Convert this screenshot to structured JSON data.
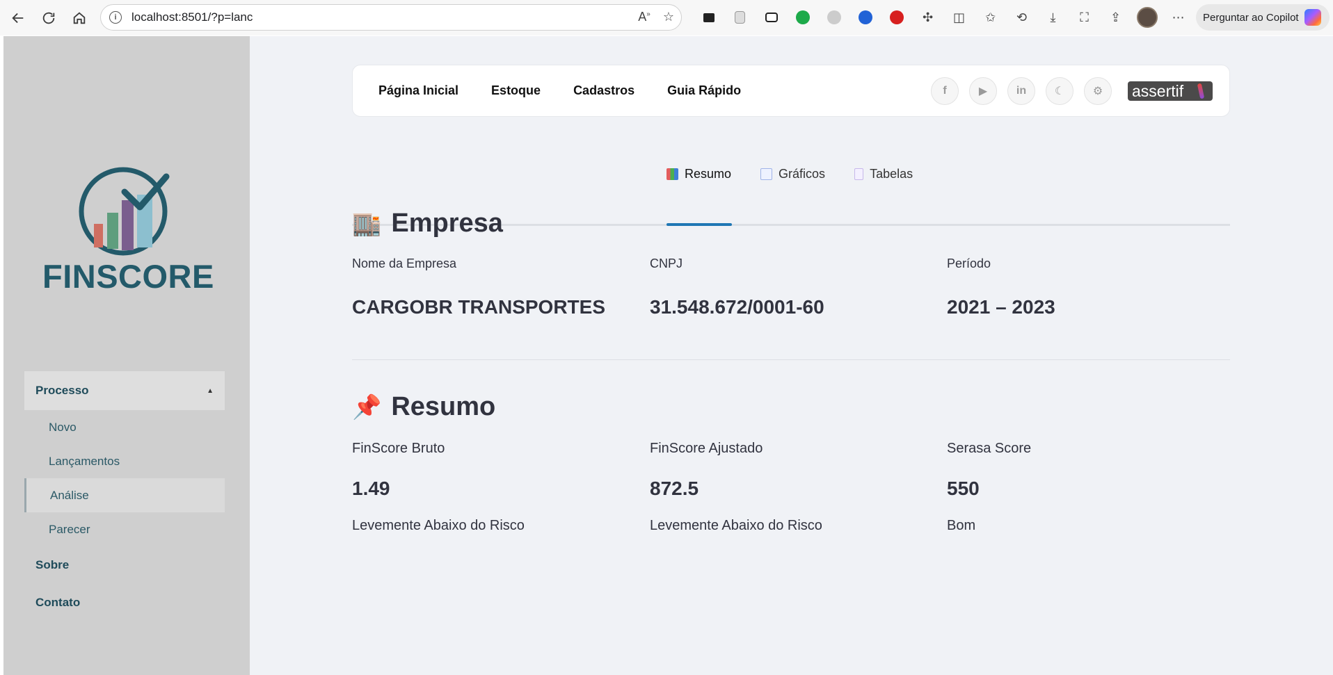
{
  "browser": {
    "url": "localhost:8501/?p=lanc",
    "copilot_label": "Perguntar ao Copilot"
  },
  "sidebar": {
    "logo_text": "FINSCORE",
    "menu": {
      "group_label": "Processo",
      "items": [
        "Novo",
        "Lançamentos",
        "Análise",
        "Parecer"
      ],
      "active_item": "Análise",
      "top_items": [
        "Sobre",
        "Contato"
      ]
    }
  },
  "topnav": {
    "links": [
      "Página Inicial",
      "Estoque",
      "Cadastros",
      "Guia Rápido"
    ],
    "brand_badge": "assertif"
  },
  "tabs": {
    "items": [
      {
        "label": "Resumo",
        "icon": "bar-chart-icon"
      },
      {
        "label": "Gráficos",
        "icon": "line-chart-icon"
      },
      {
        "label": "Tabelas",
        "icon": "document-icon"
      }
    ],
    "active": "Resumo"
  },
  "empresa": {
    "title": "Empresa",
    "emoji": "🏬",
    "fields": [
      {
        "label": "Nome da Empresa",
        "value": "CARGOBR TRANSPORTES"
      },
      {
        "label": "CNPJ",
        "value": "31.548.672/0001-60"
      },
      {
        "label": "Período",
        "value": "2021 – 2023"
      }
    ]
  },
  "resumo": {
    "title": "Resumo",
    "emoji": "📌",
    "metrics": [
      {
        "label": "FinScore Bruto",
        "value": "1.49",
        "status": "Levemente Abaixo do Risco"
      },
      {
        "label": "FinScore Ajustado",
        "value": "872.5",
        "status": "Levemente Abaixo do Risco"
      },
      {
        "label": "Serasa Score",
        "value": "550",
        "status": "Bom"
      }
    ]
  },
  "colors": {
    "accent": "#1f77b4",
    "brand": "#235a6a",
    "sidebar_bg": "#cfcfcf",
    "app_bg": "#f0f2f6"
  }
}
